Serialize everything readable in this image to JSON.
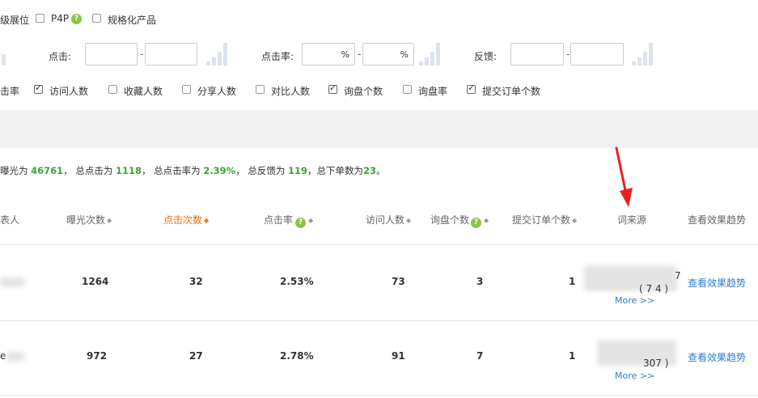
{
  "filters": {
    "row1": [
      {
        "label": "级展位",
        "checkbox": false
      },
      {
        "label": "P4P",
        "checkbox": false,
        "help": true
      },
      {
        "label": "规格化产品",
        "checkbox": false
      }
    ],
    "range_filters": [
      {
        "label": "点击:",
        "unit": ""
      },
      {
        "label": "点击率:",
        "unit": "%"
      },
      {
        "label": "反馈:",
        "unit": ""
      }
    ],
    "columns": [
      {
        "label": "击率",
        "checked": false
      },
      {
        "label": "访问人数",
        "checked": true
      },
      {
        "label": "收藏人数",
        "checked": false
      },
      {
        "label": "分享人数",
        "checked": false
      },
      {
        "label": "对比人数",
        "checked": false
      },
      {
        "label": "询盘个数",
        "checked": true
      },
      {
        "label": "询盘率",
        "checked": false
      },
      {
        "label": "提交订单个数",
        "checked": true
      }
    ],
    "dash": "-",
    "percent": "%"
  },
  "summary": {
    "p1": "曝光为 ",
    "exposure": "46761",
    "p2": "， 总点击为 ",
    "clicks": "1118",
    "p3": "， 总点击率为 ",
    "ctr": "2.39%",
    "p4": "， 总反馈为 ",
    "feedback": "119",
    "p5": "，总下单数为",
    "orders": "23",
    "p6": "。"
  },
  "table": {
    "headers": {
      "h0": "表人",
      "h1": "曝光次数",
      "h2": "点击次数",
      "h3": "点击率",
      "h4": "访问人数",
      "h5": "询盘个数",
      "h6": "提交订单个数",
      "h7": "词来源",
      "h8": "查看效果趋势"
    },
    "sort_glyph": "◆",
    "rows": [
      {
        "c0": "",
        "exposure": "1264",
        "clicks": "32",
        "ctr": "2.53%",
        "visitors": "73",
        "inquiries": "3",
        "orders": "1",
        "src_a": "7",
        "src_b": "( 7 4 )",
        "more": "More >>",
        "trend": "查看效果趋势"
      },
      {
        "c0": "e",
        "exposure": "972",
        "clicks": "27",
        "ctr": "2.78%",
        "visitors": "91",
        "inquiries": "7",
        "orders": "1",
        "src_a": "",
        "src_b": "307 )",
        "more": "More >>",
        "trend": "查看效果趋势"
      }
    ]
  },
  "colors": {
    "accent": "#ff6a00",
    "green": "#3ca23c",
    "link": "#2e7bd4",
    "arrow": "#e8211d"
  }
}
